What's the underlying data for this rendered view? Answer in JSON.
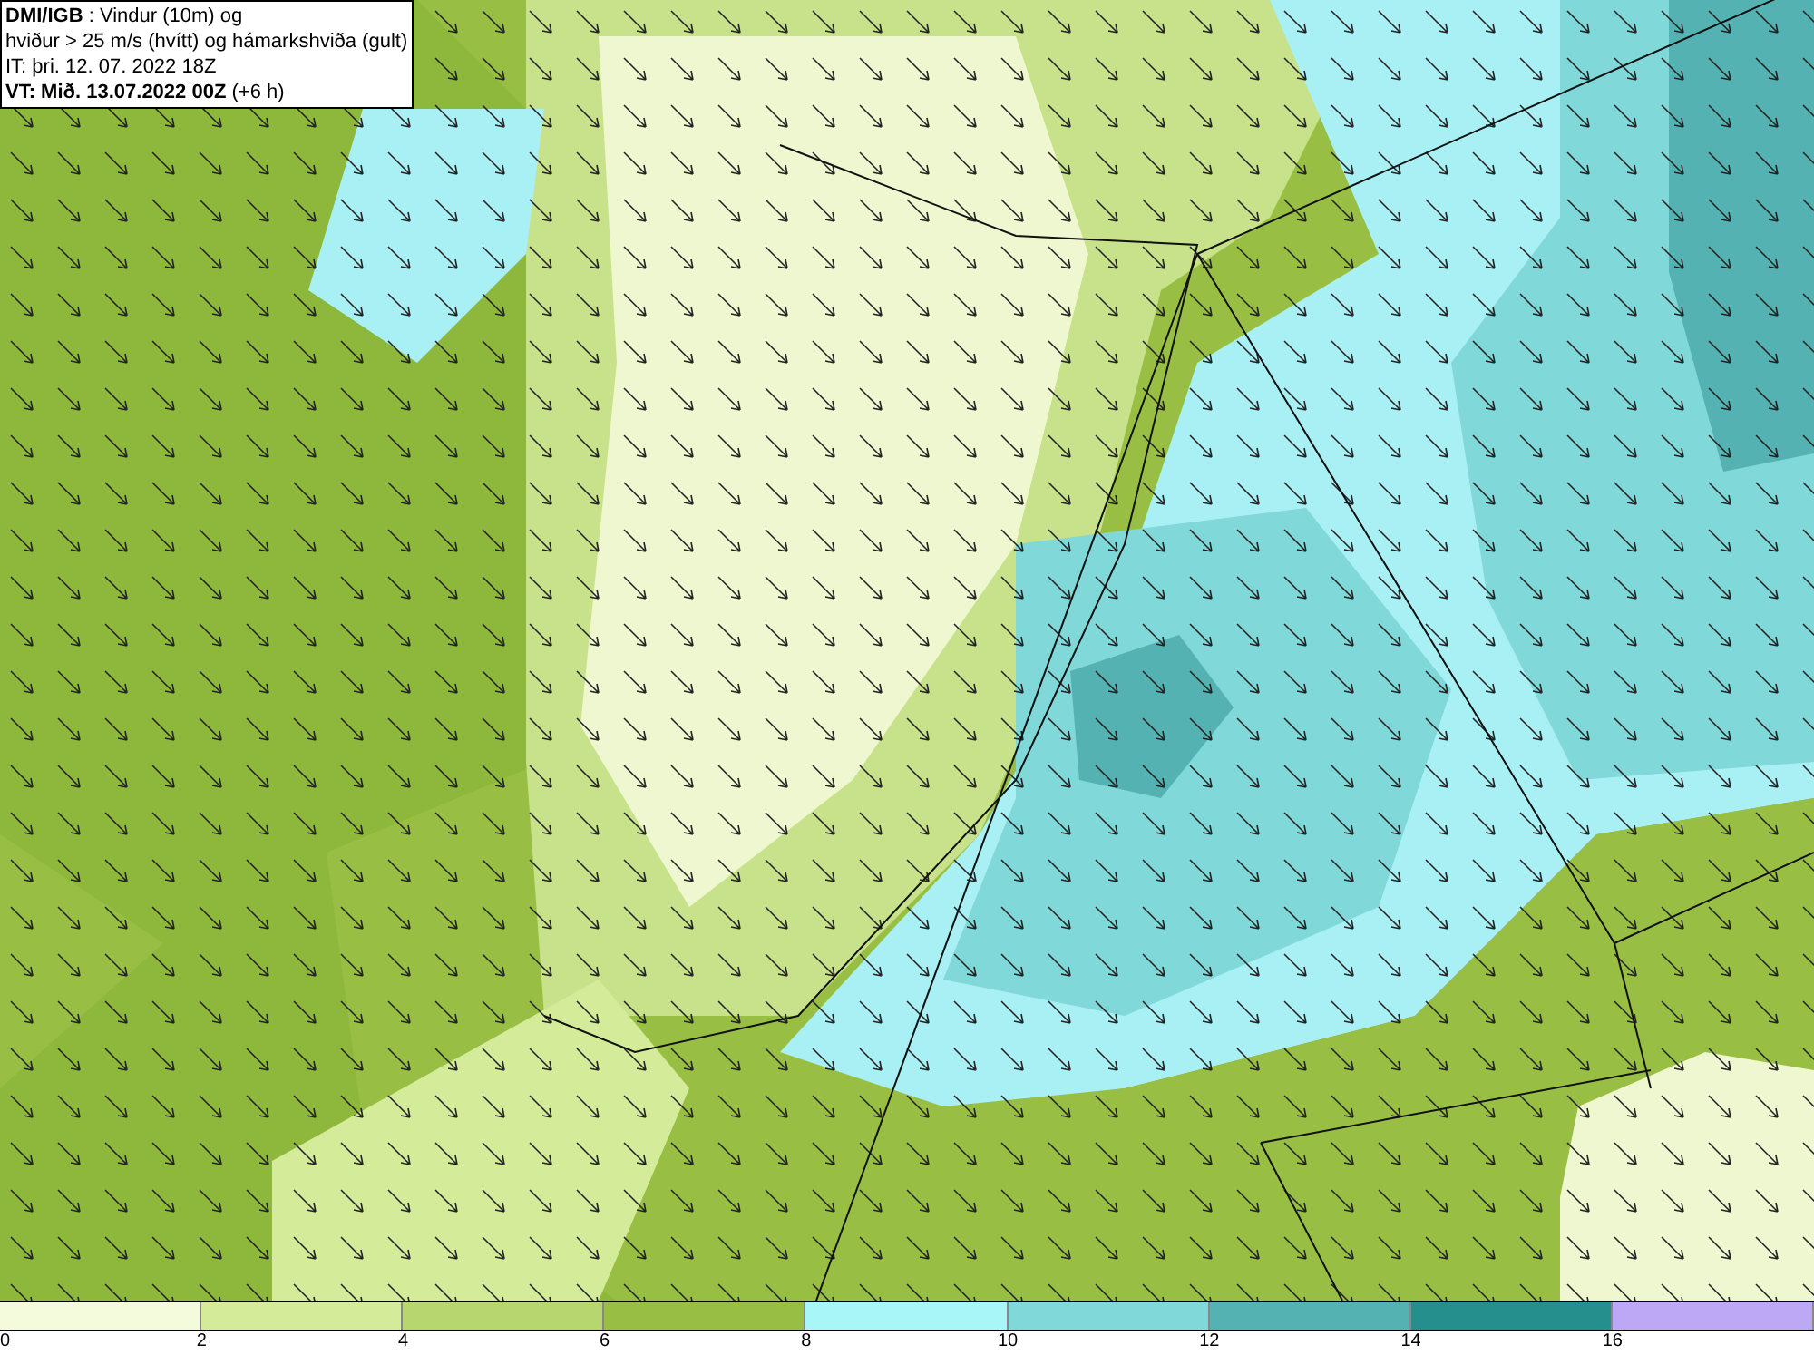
{
  "header": {
    "lines": [
      "**DMI/IGB** : Vindur (10m) og",
      "hviður > 25 m/s (hvítt) og hámarkshviða (gult)",
      "IT: þri. 12. 07. 2022 18Z",
      "**VT: Mið. 13.07.2022 00Z** (+6 h)"
    ]
  },
  "legend": {
    "bins": [
      {
        "color": "#f4fbdc"
      },
      {
        "color": "#d4ec9a"
      },
      {
        "color": "#b7d670"
      },
      {
        "color": "#98bf44"
      },
      {
        "color": "#a8f6f8"
      },
      {
        "color": "#80d8d8"
      },
      {
        "color": "#55b2b2"
      },
      {
        "color": "#248f8c"
      },
      {
        "color": "#bca8f4"
      }
    ],
    "ticks": [
      "0",
      "2",
      "4",
      "6",
      "8",
      "10",
      "12",
      "14",
      "16"
    ]
  }
}
